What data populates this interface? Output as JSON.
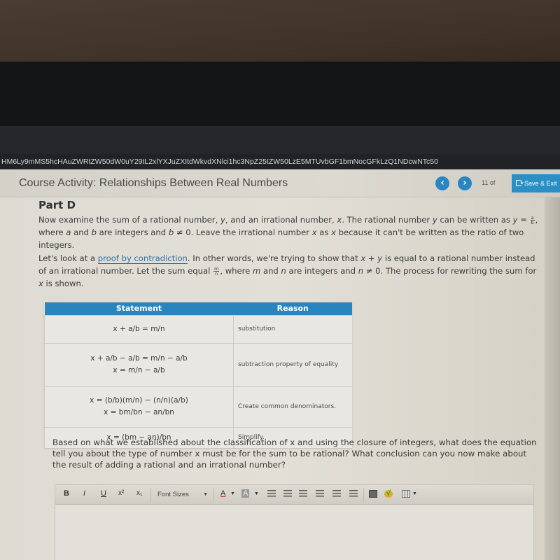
{
  "browser": {
    "url_fragment": "HM6Ly9mMS5hcHAuZWRtZW50dW0uY29tL2xlYXJuZXItdWkvdXNlci1hc3NpZ25tZW50LzE5MTUvbGF1bmNocGFkLzQ1NDcwNTc50"
  },
  "header": {
    "course_title": "Course Activity: Relationships Between Real Numbers",
    "prev_icon": "chevron-left-icon",
    "next_icon": "chevron-right-icon",
    "page_counter": "11 of",
    "save_exit_label": "Save & Exit",
    "accent_color": "#2a86c2"
  },
  "part": {
    "title": "Part D",
    "para1": {
      "t1": "Now examine the sum of a rational number, ",
      "y": "y",
      "t2": ", and an irrational number, ",
      "x": "x",
      "t3": ". The rational number ",
      "t4": " can be written as ",
      "eq": "y = ",
      "frac_num": "a",
      "frac_den": "b",
      "t5": ",",
      "t6": "where ",
      "a": "a",
      "t7": " and ",
      "b": "b",
      "t8": " are integers and ",
      "t9": " ≠ 0. Leave the irrational number ",
      "t10": " as ",
      "t11": " because it can't be written as the ratio of two integers."
    },
    "para2": {
      "t1": "Let's look at a ",
      "link": "proof by contradiction",
      "t2": ". In other words, we're trying to show that ",
      "expr": "x + y",
      "t3": " is equal to a rational number instead of an irrational number. Let the sum equal ",
      "frac_num": "m",
      "frac_den": "n",
      "t4": ", where ",
      "m": "m",
      "t5": " and ",
      "n": "n",
      "t6": " are integers and ",
      "t7": " ≠ 0. The process for rewriting the sum for ",
      "t8": " is shown."
    }
  },
  "table": {
    "headers": [
      "Statement",
      "Reason"
    ],
    "rows": [
      {
        "statements": [
          "x + a/b = m/n"
        ],
        "reason": "substitution"
      },
      {
        "statements": [
          "x + a/b − a/b = m/n − a/b",
          "x = m/n − a/b"
        ],
        "reason": "subtraction property of equality"
      },
      {
        "statements": [
          "x = (b/b)(m/n) − (n/n)(a/b)",
          "x = bm/bn − an/bn"
        ],
        "reason": "Create common denominators."
      },
      {
        "statements": [
          "x = (bm − an)/bn"
        ],
        "reason": "Simplify."
      }
    ]
  },
  "question": {
    "text": "Based on what we established about the classification of x and using the closure of integers, what does the equation tell you about the type of number x must be for the sum to be rational? What conclusion can you now make about the result of adding a rational and an irrational number?"
  },
  "editor": {
    "bold": "B",
    "italic": "I",
    "underline": "U",
    "superscript": "x²",
    "subscript": "x₁",
    "font_sizes": "Font Sizes",
    "font_color": "A",
    "highlight": "A",
    "value": ""
  }
}
